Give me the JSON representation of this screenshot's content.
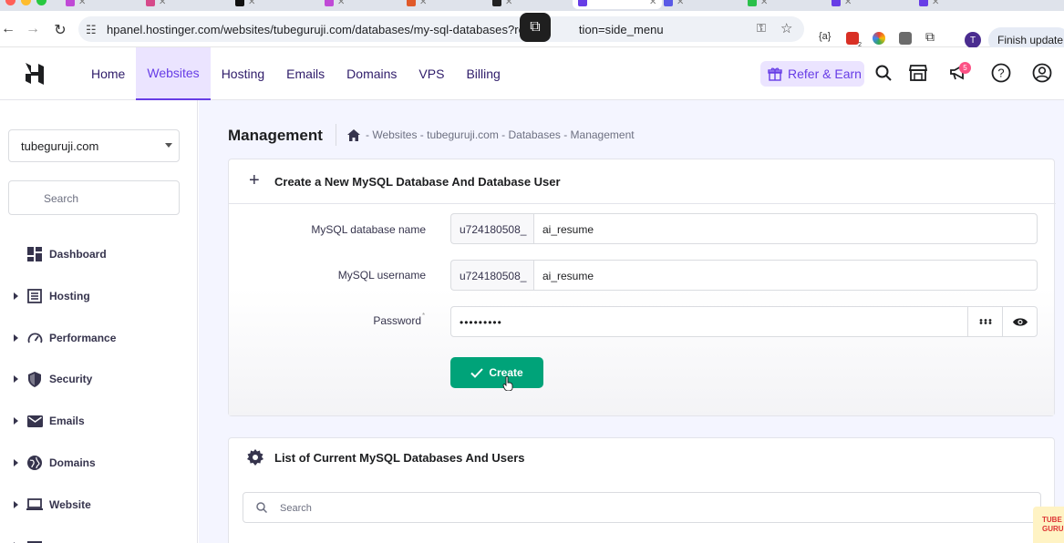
{
  "browser": {
    "url": "hpanel.hostinger.com/websites/tubeguruji.com/databases/my-sql-databases?redire",
    "url_tail": "tion=side_menu",
    "finish_update_label": "Finish update",
    "profile_initial": "T",
    "extension_badge": "2",
    "ext_label": "{a}"
  },
  "header": {
    "nav": [
      "Home",
      "Websites",
      "Hosting",
      "Emails",
      "Domains",
      "VPS",
      "Billing"
    ],
    "active_nav": "Websites",
    "refer_label": "Refer & Earn",
    "notification_count": "5",
    "accent": "#673de6"
  },
  "sidebar": {
    "site": "tubeguruji.com",
    "search_placeholder": "Search",
    "items": [
      {
        "label": "Dashboard",
        "icon": "dashboard-icon",
        "expandable": false
      },
      {
        "label": "Hosting",
        "icon": "hosting-icon",
        "expandable": true
      },
      {
        "label": "Performance",
        "icon": "performance-icon",
        "expandable": true
      },
      {
        "label": "Security",
        "icon": "shield-icon",
        "expandable": true
      },
      {
        "label": "Emails",
        "icon": "mail-icon",
        "expandable": true
      },
      {
        "label": "Domains",
        "icon": "globe-icon",
        "expandable": true
      },
      {
        "label": "Website",
        "icon": "laptop-icon",
        "expandable": true
      }
    ]
  },
  "main": {
    "title": "Management",
    "breadcrumb": "- Websites - tubeguruji.com - Databases - Management",
    "create_card": {
      "title": "Create a New MySQL Database And Database User",
      "db_name_label": "MySQL database name",
      "db_prefix": "u724180508_",
      "db_name_value": "ai_resume",
      "username_label": "MySQL username",
      "username_prefix": "u724180508_",
      "username_value": "ai_resume",
      "password_label": "Password",
      "password_value": "•••••••••",
      "create_label": "Create",
      "create_color": "#00a379"
    },
    "list_card": {
      "title": "List of Current MySQL Databases And Users",
      "search_placeholder": "Search"
    }
  },
  "watermark": {
    "text_1": "TUBE",
    "text_2": "GURU"
  }
}
